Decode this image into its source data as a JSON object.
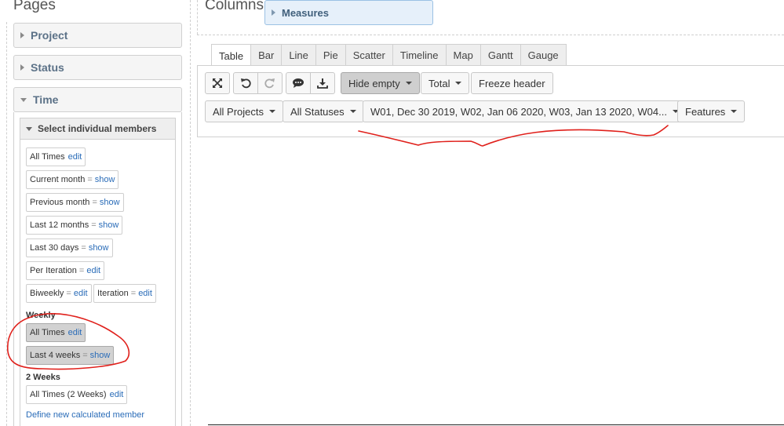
{
  "sidebar": {
    "title": "Pages",
    "panels": {
      "project": "Project",
      "status": "Status",
      "time": "Time"
    },
    "select_members_header": "Select individual members",
    "members": {
      "all_times": {
        "label": "All Times",
        "action": "edit"
      },
      "current_month": {
        "label": "Current month",
        "eq": "=",
        "action": "show"
      },
      "previous_month": {
        "label": "Previous month",
        "eq": "=",
        "action": "show"
      },
      "last_12_months": {
        "label": "Last 12 months",
        "eq": "=",
        "action": "show"
      },
      "last_30_days": {
        "label": "Last 30 days",
        "eq": "=",
        "action": "show"
      },
      "per_iteration": {
        "label": "Per Iteration",
        "eq": "=",
        "action": "edit"
      },
      "biweekly": {
        "label": "Biweekly",
        "eq": "=",
        "action": "edit"
      },
      "iteration": {
        "label": "Iteration",
        "eq": "=",
        "action": "edit"
      }
    },
    "weekly": {
      "label": "Weekly",
      "all_times": {
        "label": "All Times",
        "action": "edit"
      },
      "last_4_weeks": {
        "label": "Last 4 weeks",
        "eq": "=",
        "action": "show"
      }
    },
    "two_weeks": {
      "label": "2 Weeks",
      "all_times": {
        "label": "All Times (2 Weeks)",
        "action": "edit"
      }
    },
    "define_link": "Define new calculated member"
  },
  "columns": {
    "title": "Columns",
    "measures": "Measures"
  },
  "tabs": [
    "Table",
    "Bar",
    "Line",
    "Pie",
    "Scatter",
    "Timeline",
    "Map",
    "Gantt",
    "Gauge"
  ],
  "active_tab": "Table",
  "toolbar": {
    "hide_empty": "Hide empty",
    "total": "Total",
    "freeze_header": "Freeze header"
  },
  "filters": {
    "projects": "All Projects",
    "statuses": "All Statuses",
    "time": "W01, Dec 30 2019, W02, Jan 06 2020, W03, Jan 13 2020, W04...",
    "features": "Features"
  },
  "annotation_color": "#e0201b"
}
